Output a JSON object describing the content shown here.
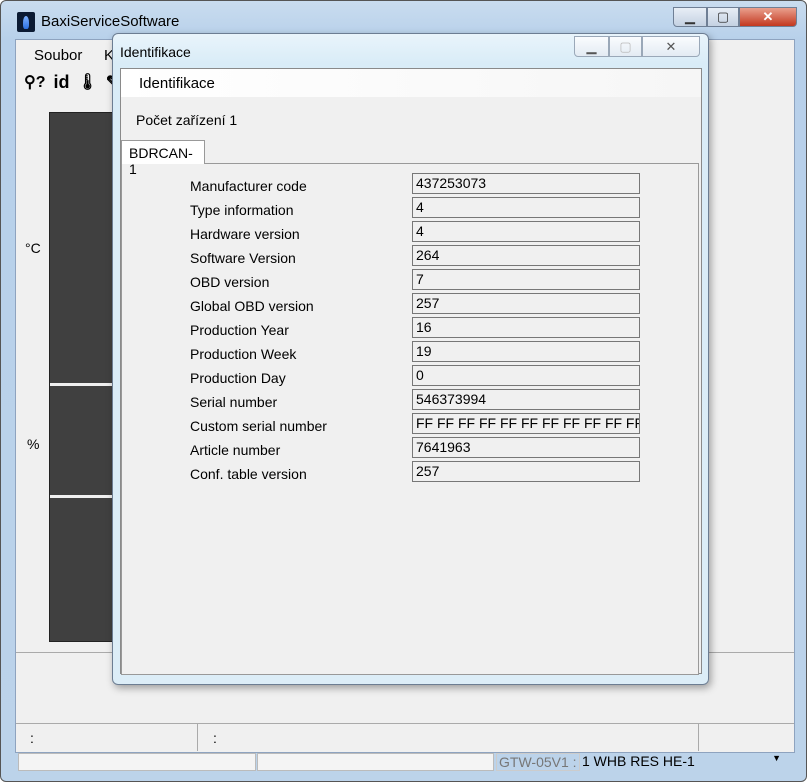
{
  "main_window": {
    "title": "BaxiServiceSoftware",
    "menu": [
      "Soubor",
      "K"
    ],
    "toolbar": [
      "plug-question-icon",
      "id-icon",
      "thermometer-icon",
      "wrench-icon"
    ],
    "toolbar_text": {
      "id": "id"
    },
    "units": {
      "temperature": "°C",
      "percent": "%"
    },
    "status": {
      "left": ":",
      "middle": ":",
      "gateway_label": "GTW-05V1 :",
      "device_select": "1 WHB RES HE-1"
    }
  },
  "dialog": {
    "title": "Identifikace",
    "header": "Identifikace",
    "device_count_label": "Počet zařízení 1",
    "tab": "BDRCAN-1",
    "fields": [
      {
        "label": "Manufacturer code",
        "value": "437253073"
      },
      {
        "label": "Type information",
        "value": "4"
      },
      {
        "label": "Hardware version",
        "value": "4"
      },
      {
        "label": "Software Version",
        "value": "264"
      },
      {
        "label": "OBD version",
        "value": "7"
      },
      {
        "label": "Global OBD version",
        "value": "257"
      },
      {
        "label": "Production Year",
        "value": "16"
      },
      {
        "label": "Production Week",
        "value": "19"
      },
      {
        "label": "Production Day",
        "value": "0"
      },
      {
        "label": "Serial number",
        "value": "546373994"
      },
      {
        "label": "Custom serial number",
        "value": "FF FF FF FF FF FF FF FF FF FF FF"
      },
      {
        "label": "Article number",
        "value": "7641963"
      },
      {
        "label": "Conf. table version",
        "value": "257"
      }
    ]
  }
}
